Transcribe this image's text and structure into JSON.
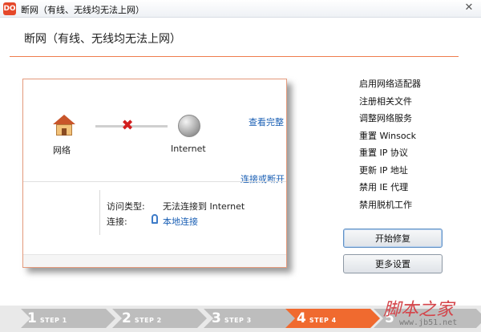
{
  "window": {
    "icon_text": "DO",
    "title": "断网（有线、无线均无法上网）",
    "close_glyph": "✕"
  },
  "header": {
    "title": "断网（有线、无线均无法上网）"
  },
  "diagram": {
    "network_label": "网络",
    "internet_label": "Internet",
    "view_full_link": "查看完整",
    "connect_link": "连接或断开"
  },
  "status": {
    "access_type_label": "访问类型:",
    "access_type_value": "无法连接到 Internet",
    "connection_label": "连接:",
    "connection_value": "本地连接"
  },
  "tasks": [
    "启用网络适配器",
    "注册相关文件",
    "调整网络服务",
    "重置 Winsock",
    "重置 IP 协议",
    "更新 IP 地址",
    "禁用 IE 代理",
    "禁用脱机工作"
  ],
  "buttons": {
    "start_repair": "开始修复",
    "more_settings": "更多设置"
  },
  "steps": [
    {
      "num": "1",
      "word": "STEP 1",
      "active": false
    },
    {
      "num": "2",
      "word": "STEP 2",
      "active": false
    },
    {
      "num": "3",
      "word": "STEP 3",
      "active": false
    },
    {
      "num": "4",
      "word": "STEP 4",
      "active": true
    },
    {
      "num": "5",
      "word": "",
      "active": false
    }
  ],
  "colors": {
    "accent": "#ef7d4d",
    "step_inactive": "#bdbdbd",
    "step_active": "#f06a2f",
    "link": "#1a5fb4"
  },
  "watermark": {
    "text": "脚本之家",
    "sub": "www.jb51.net"
  }
}
